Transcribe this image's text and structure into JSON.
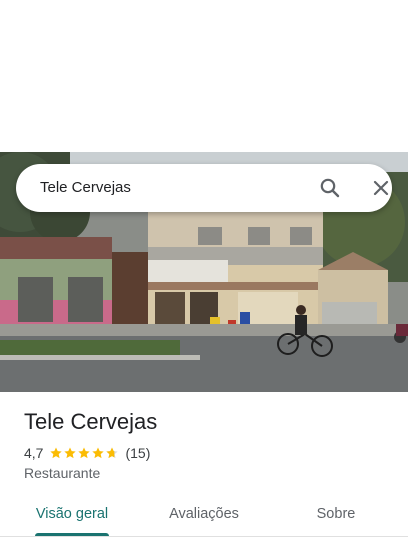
{
  "search": {
    "query": "Tele Cervejas",
    "search_icon": "search-icon",
    "close_icon": "close-icon"
  },
  "place": {
    "name": "Tele Cervejas",
    "rating": "4,7",
    "rating_value": 4.7,
    "review_count": "(15)",
    "category": "Restaurante",
    "star_color": "#fbbc04"
  },
  "tabs": [
    {
      "label": "Visão geral",
      "active": true
    },
    {
      "label": "Avaliações",
      "active": false
    },
    {
      "label": "Sobre",
      "active": false
    }
  ],
  "colors": {
    "accent": "#1a7370",
    "text_primary": "#202124",
    "text_secondary": "#5f6368"
  }
}
